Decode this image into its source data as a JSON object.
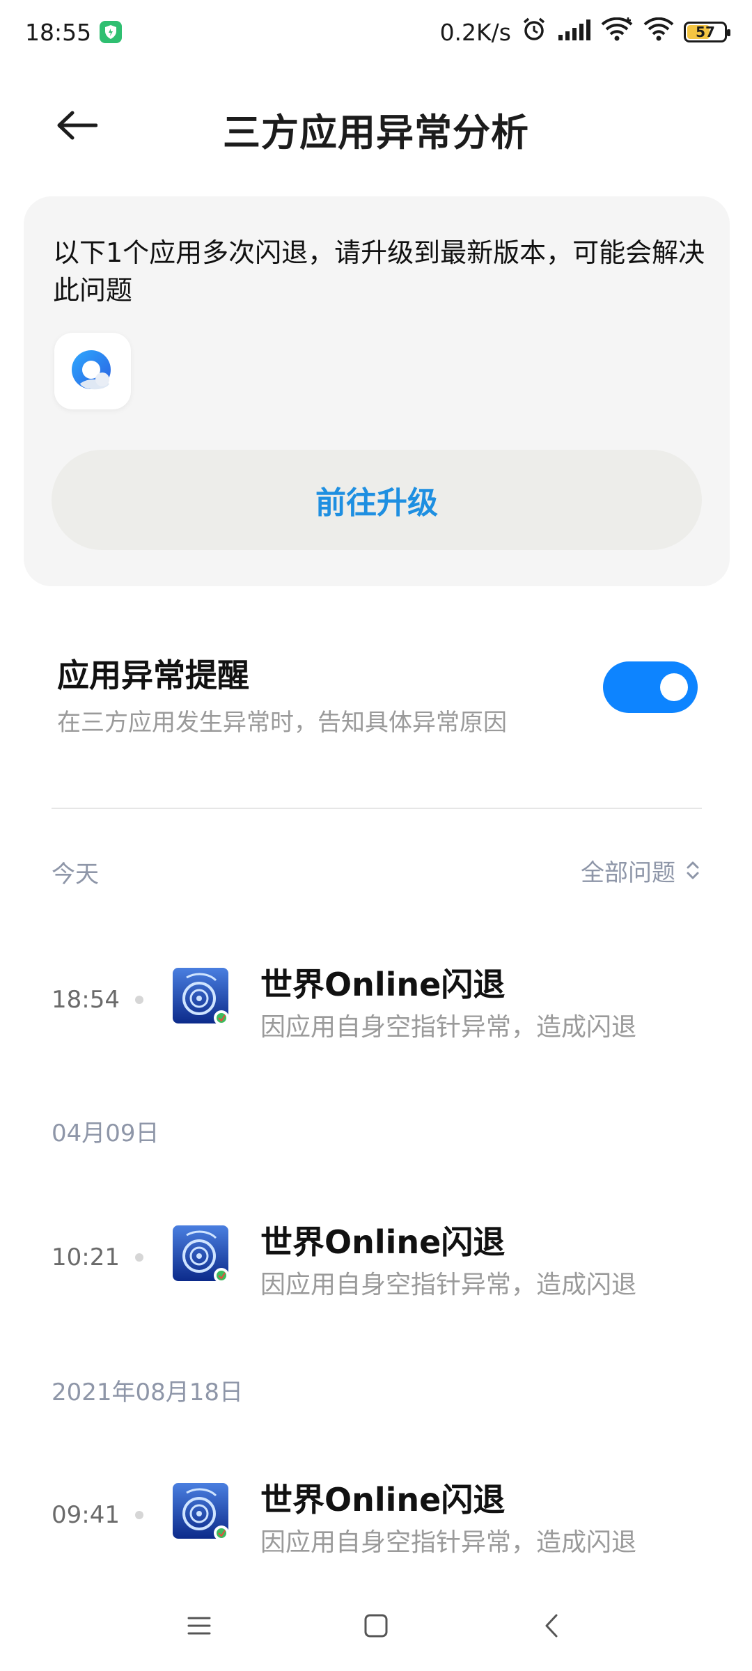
{
  "status_bar": {
    "time": "18:55",
    "network_speed": "0.2K/s",
    "battery_level": "57",
    "battery_fraction": 0.57,
    "icons": [
      "shield-icon",
      "alarm-icon",
      "signal-icon",
      "wifi-icon",
      "wifi-plus-icon",
      "battery-icon"
    ]
  },
  "header": {
    "title": "三方应用异常分析",
    "back_icon": "arrow-left-icon"
  },
  "upgrade_card": {
    "message": "以下1个应用多次闪退，请升级到最新版本，可能会解决此问题",
    "app_icon": "browser-app-icon",
    "button_label": "前往升级",
    "accent_color": "#1e8fe1"
  },
  "alert_setting": {
    "title": "应用异常提醒",
    "description": "在三方应用发生异常时，告知具体异常原因",
    "enabled": true,
    "toggle_color": "#0d84ff"
  },
  "filter": {
    "section_label": "今天",
    "dropdown_label": "全部问题",
    "dropdown_icon": "chevron-up-down-icon"
  },
  "records": [
    {
      "date_header": "",
      "time": "18:54",
      "title": "世界Online闪退",
      "description": "因应用自身空指针异常，造成闪退",
      "icon": "world-online-app-icon"
    },
    {
      "date_header": "04月09日",
      "time": "10:21",
      "title": "世界Online闪退",
      "description": "因应用自身空指针异常，造成闪退",
      "icon": "world-online-app-icon"
    },
    {
      "date_header": "2021年08月18日",
      "time": "09:41",
      "title": "世界Online闪退",
      "description": "因应用自身空指针异常，造成闪退",
      "icon": "world-online-app-icon"
    }
  ],
  "nav_bar": {
    "items": [
      "menu-icon",
      "home-icon",
      "back-icon"
    ]
  }
}
